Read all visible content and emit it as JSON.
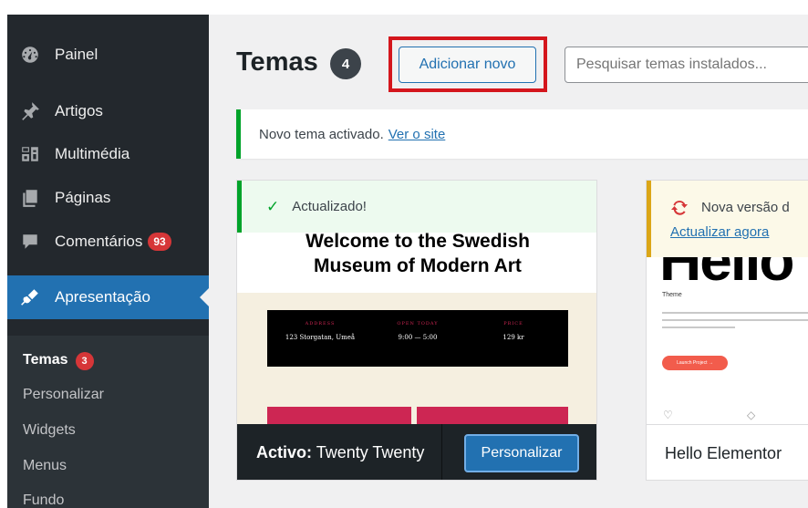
{
  "sidebar": {
    "items": [
      {
        "label": "Painel",
        "icon": "dashboard-icon"
      },
      {
        "label": "Artigos",
        "icon": "pin-icon"
      },
      {
        "label": "Multimédia",
        "icon": "media-icon"
      },
      {
        "label": "Páginas",
        "icon": "pages-icon"
      },
      {
        "label": "Comentários",
        "icon": "comments-icon",
        "badge": "93"
      },
      {
        "label": "Apresentação",
        "icon": "appearance-icon",
        "active": true
      }
    ],
    "submenu": [
      {
        "label": "Temas",
        "badge": "3",
        "current": true
      },
      {
        "label": "Personalizar"
      },
      {
        "label": "Widgets"
      },
      {
        "label": "Menus"
      },
      {
        "label": "Fundo"
      }
    ]
  },
  "header": {
    "title": "Temas",
    "count": "4",
    "add_new_label": "Adicionar novo",
    "search_placeholder": "Pesquisar temas instalados..."
  },
  "notice": {
    "text": "Novo tema activado.",
    "link": "Ver o site"
  },
  "themes": [
    {
      "update_notice": "Actualizado!",
      "screenshot": {
        "headline_line1": "Welcome to the Swedish",
        "headline_line2": "Museum of Modern Art",
        "bar_cols": [
          {
            "label": "ADDRESS",
            "value": "123 Storgatan, Umeå"
          },
          {
            "label": "OPEN TODAY",
            "value": "9:00 — 5:00"
          },
          {
            "label": "PRICE",
            "value": "129 kr"
          }
        ]
      },
      "active_prefix": "Activo:",
      "name": "Twenty Twenty",
      "customize_label": "Personalizar"
    },
    {
      "update_notice": "Nova versão d",
      "update_link": "Actualizar agora",
      "screenshot": {
        "big_text": "Hello",
        "theme_label": "Theme",
        "launch_label": "Launch Project →"
      },
      "name": "Hello Elementor"
    }
  ],
  "colors": {
    "sidebar_bg": "#23282d",
    "accent": "#2271b1",
    "badge_red": "#d63638",
    "success_green": "#00a32a",
    "warning_yellow": "#dba617",
    "highlight_red": "#d4161d"
  }
}
